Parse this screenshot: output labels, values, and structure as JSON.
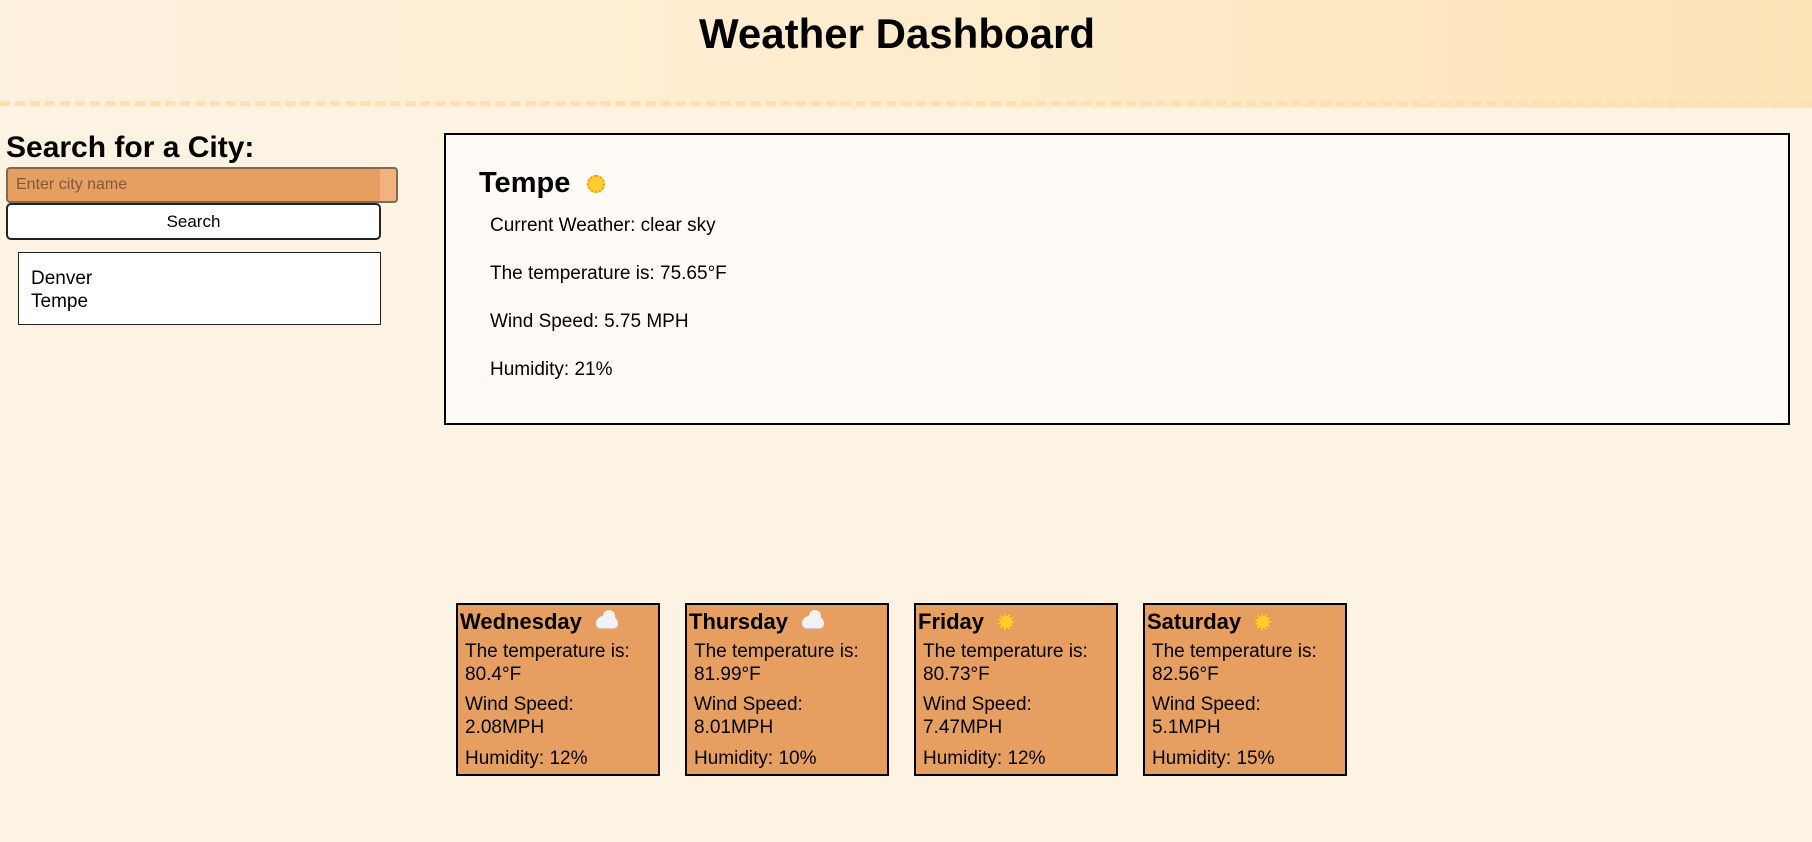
{
  "header": {
    "title": "Weather Dashboard"
  },
  "search": {
    "heading": "Search for a City:",
    "placeholder": "Enter city name",
    "value": "",
    "button_label": "Search",
    "history": [
      "Denver",
      "Tempe"
    ]
  },
  "current": {
    "city": "Tempe",
    "icon": "sun-icon",
    "weather_line": "Current Weather: clear sky",
    "temp_line": "The temperature is: 75.65°F",
    "wind_line": "Wind Speed: 5.75 MPH",
    "humidity_line": "Humidity: 21%"
  },
  "forecast": [
    {
      "day": "Wednesday",
      "icon": "cloud-icon",
      "temp_label": "The temperature is:",
      "temp": "80.4°F",
      "wind_label": "Wind Speed:",
      "wind": "2.08MPH",
      "humidity": "Humidity: 12%"
    },
    {
      "day": "Thursday",
      "icon": "cloud-icon",
      "temp_label": "The temperature is:",
      "temp": "81.99°F",
      "wind_label": "Wind Speed:",
      "wind": "8.01MPH",
      "humidity": "Humidity: 10%"
    },
    {
      "day": "Friday",
      "icon": "sun-icon",
      "temp_label": "The temperature is:",
      "temp": "80.73°F",
      "wind_label": "Wind Speed:",
      "wind": "7.47MPH",
      "humidity": "Humidity: 12%"
    },
    {
      "day": "Saturday",
      "icon": "sun-icon",
      "temp_label": "The temperature is:",
      "temp": "82.56°F",
      "wind_label": "Wind Speed:",
      "wind": "5.1MPH",
      "humidity": "Humidity: 15%"
    }
  ],
  "colors": {
    "background": "#fdf3e3",
    "accent": "#e69f60",
    "panel": "#fffaf5"
  }
}
